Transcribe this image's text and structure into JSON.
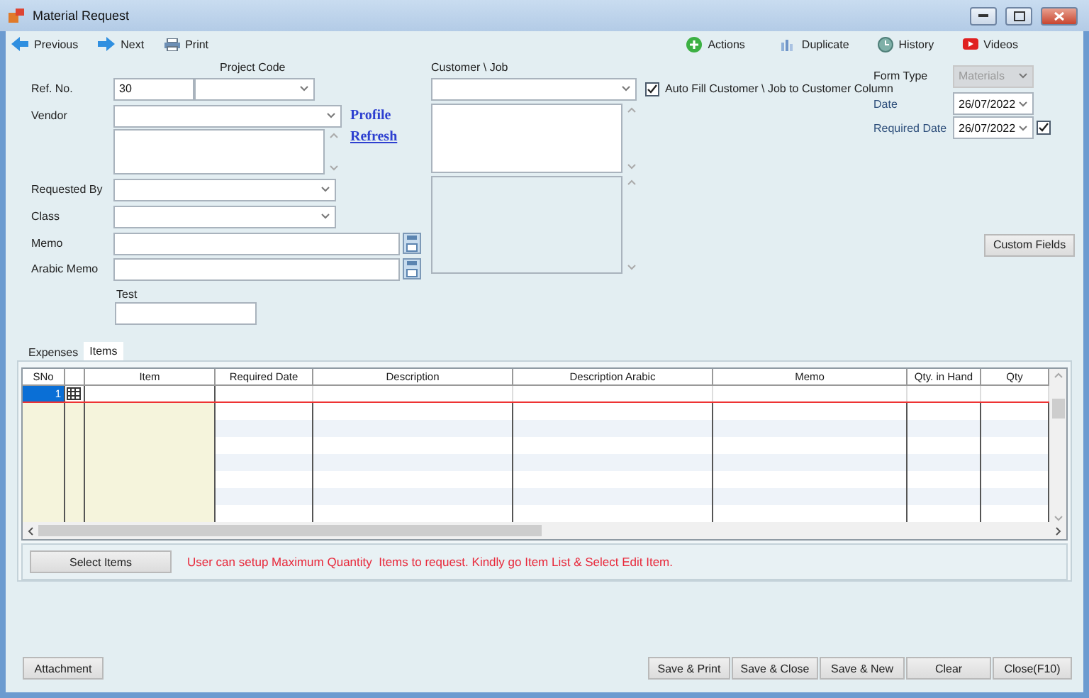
{
  "window": {
    "title": "Material Request"
  },
  "toolbar_left": [
    {
      "label": "Previous",
      "kind": "previous"
    },
    {
      "label": "Next",
      "kind": "next"
    },
    {
      "label": "Print",
      "kind": "print"
    }
  ],
  "toolbar_right": [
    {
      "label": "Actions",
      "kind": "actions"
    },
    {
      "label": "Duplicate",
      "kind": "duplicate"
    },
    {
      "label": "History",
      "kind": "history"
    },
    {
      "label": "Videos",
      "kind": "videos"
    }
  ],
  "ref_no": {
    "label": "Ref. No.",
    "value": "30"
  },
  "project_code": {
    "label": "Project Code"
  },
  "vendor": {
    "label": "Vendor"
  },
  "links": [
    "Profile",
    "Refresh"
  ],
  "requested_by": {
    "label": "Requested By"
  },
  "class": {
    "label": "Class"
  },
  "memo": {
    "label": "Memo"
  },
  "arabic_memo": {
    "label": "Arabic Memo"
  },
  "test": {
    "label": "Test"
  },
  "customer_job": {
    "label": "Customer \\ Job"
  },
  "auto_fill": {
    "label": "Auto Fill Customer \\ Job to Customer Column",
    "checked": true
  },
  "form_type": {
    "label": "Form Type",
    "value": "Materials",
    "disabled": true
  },
  "date": {
    "label": "Date",
    "value": "26/07/2022"
  },
  "required_date": {
    "label": "Required Date",
    "value": "26/07/2022",
    "checked": true
  },
  "custom_fields_button": "Custom Fields",
  "tabs": [
    {
      "label": "Expenses",
      "selected": false
    },
    {
      "label": "Items",
      "selected": true
    }
  ],
  "table": {
    "columns": [
      "SNo",
      "",
      "Item",
      "Required Date",
      "Description",
      "Description Arabic",
      "Memo",
      "Qty. in Hand",
      "Qty"
    ],
    "rows": [
      {
        "sno": "1",
        "selected": true
      }
    ]
  },
  "select_items_button": "Select Items",
  "message": "User can setup Maximum Quantity  Items to request. Kindly go Item List & Select Edit Item.",
  "footer_left": [
    "Attachment"
  ],
  "footer_right": [
    "Save & Print",
    "Save & Close",
    "Save & New",
    "Clear",
    "Close(F10)"
  ]
}
